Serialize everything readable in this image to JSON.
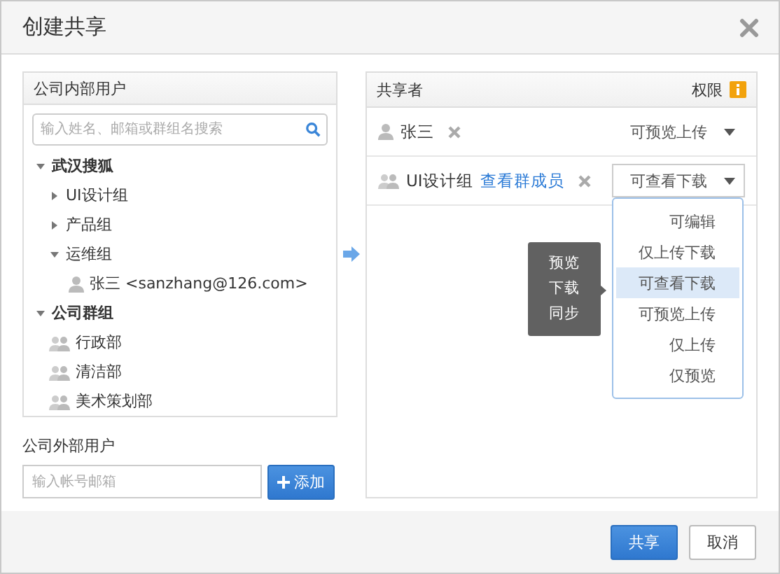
{
  "window": {
    "title": "创建共享"
  },
  "internal_panel": {
    "title": "公司内部用户",
    "search": {
      "placeholder": "输入姓名、邮箱或群组名搜索"
    },
    "tree": [
      {
        "label": "武汉搜狐",
        "kind": "folder",
        "expanded": true,
        "children": [
          {
            "label": "UI设计组",
            "kind": "folder",
            "expanded": false
          },
          {
            "label": "产品组",
            "kind": "folder",
            "expanded": false
          },
          {
            "label": "运维组",
            "kind": "folder",
            "expanded": true,
            "children": [
              {
                "label": "张三 <sanzhang@126.com>",
                "kind": "user"
              }
            ]
          }
        ]
      },
      {
        "label": "公司群组",
        "kind": "folder",
        "expanded": true,
        "children": [
          {
            "label": "行政部",
            "kind": "team"
          },
          {
            "label": "清洁部",
            "kind": "team"
          },
          {
            "label": "美术策划部",
            "kind": "team"
          }
        ]
      }
    ]
  },
  "external": {
    "label": "公司外部用户",
    "placeholder": "输入帐号邮箱",
    "add_button": "添加"
  },
  "sharers_panel": {
    "title": "共享者",
    "permission_label": "权限",
    "rows": [
      {
        "kind": "user",
        "name": "张三",
        "permission": "可预览上传",
        "open": false
      },
      {
        "kind": "team",
        "name": "UI设计组",
        "link": "查看群成员",
        "permission": "可查看下载",
        "open": true
      }
    ]
  },
  "permission_menu": {
    "items": [
      {
        "label": "可编辑",
        "selected": false
      },
      {
        "label": "仅上传下载",
        "selected": false
      },
      {
        "label": "可查看下载",
        "selected": true
      },
      {
        "label": "可预览上传",
        "selected": false
      },
      {
        "label": "仅上传",
        "selected": false
      },
      {
        "label": "仅预览",
        "selected": false
      }
    ]
  },
  "tooltip": {
    "lines": [
      "预览",
      "下载",
      "同步"
    ]
  },
  "buttons": [
    {
      "label": "共享",
      "kind": "primary"
    },
    {
      "label": "取消",
      "kind": "secondary"
    }
  ]
}
